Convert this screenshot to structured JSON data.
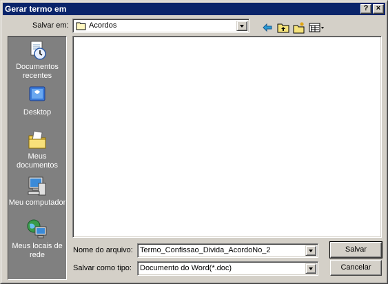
{
  "window": {
    "title": "Gerar termo em",
    "help_button": "?",
    "close_button": "×"
  },
  "save_in": {
    "label": "Salvar em:",
    "value": "Acordos"
  },
  "toolbar": {
    "back_icon": "back-arrow-icon",
    "up_icon": "up-folder-icon",
    "new_folder_icon": "new-folder-icon",
    "view_menu_icon": "view-menu-icon"
  },
  "places": [
    {
      "label": "Documentos recentes",
      "icon": "recent-documents-icon"
    },
    {
      "label": "Desktop",
      "icon": "desktop-icon"
    },
    {
      "label": "Meus documentos",
      "icon": "my-documents-icon"
    },
    {
      "label": "Meu computador",
      "icon": "my-computer-icon"
    },
    {
      "label": "Meus locais de rede",
      "icon": "network-places-icon"
    }
  ],
  "file_name": {
    "label": "Nome do arquivo:",
    "value": "Termo_Confissao_Divida_AcordoNo_2"
  },
  "file_type": {
    "label": "Salvar como tipo:",
    "value": "Documento do Word(*.doc)"
  },
  "buttons": {
    "save": "Salvar",
    "cancel": "Cancelar"
  },
  "colors": {
    "titlebar": "#0a246a",
    "face": "#d4d0c8",
    "places_bar": "#808080"
  }
}
